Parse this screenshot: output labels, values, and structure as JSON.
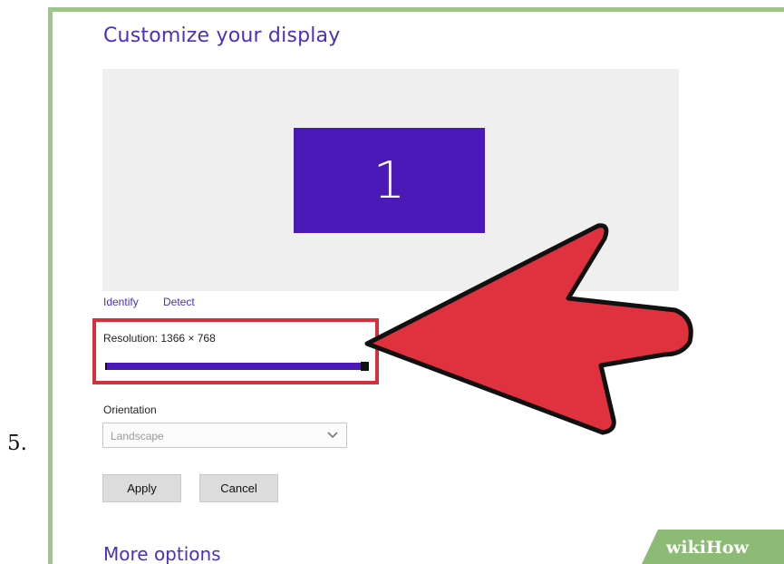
{
  "step": {
    "number": "5."
  },
  "display": {
    "title": "Customize your display",
    "monitor_number": "1",
    "links": {
      "identify": "Identify",
      "detect": "Detect"
    },
    "resolution": {
      "label": "Resolution: 1366 × 768",
      "slider_level": 1.0
    },
    "orientation": {
      "label": "Orientation",
      "value": "Landscape"
    },
    "buttons": {
      "apply": "Apply",
      "cancel": "Cancel"
    },
    "more_options": "More options"
  },
  "watermark": {
    "wiki": "wiki",
    "how": "How"
  },
  "colors": {
    "accent": "#4a2fc0",
    "monitor": "#4a19b7",
    "highlight_box": "#d6303d",
    "arrow": "#e0313f",
    "frame": "#9fc48c"
  },
  "icons": {
    "dropdown": "chevron-down-icon",
    "pointer": "red-arrow-icon"
  }
}
